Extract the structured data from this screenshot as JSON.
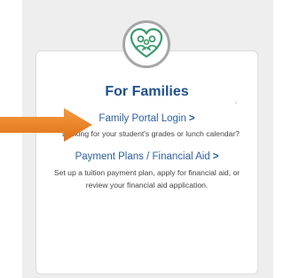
{
  "colors": {
    "panel_bg": "#eeeeee",
    "title": "#1f4f8f",
    "link": "#2e5fa3",
    "icon_stroke": "#3c9a6e",
    "arrow": "#ee7d1f"
  },
  "card": {
    "icon": "family-heart-icon",
    "title": "For Families",
    "links": [
      {
        "label": "Family Portal Login",
        "chevron": ">",
        "description_lines": [
          "Looking for your student's grades or lunch calendar?"
        ]
      },
      {
        "label": "Payment Plans / Financial Aid",
        "chevron": ">",
        "description_lines": [
          "Set up a tuition payment plan, apply for financial aid, or",
          "review your financial aid application."
        ]
      }
    ]
  },
  "annotation": {
    "icon": "orange-arrow-icon"
  }
}
